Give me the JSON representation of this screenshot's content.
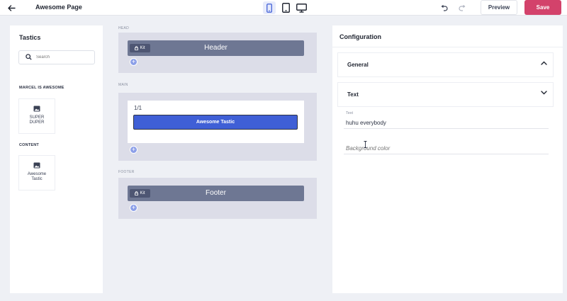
{
  "topbar": {
    "page_title": "Awesome Page",
    "back_icon": "arrow-left-icon",
    "devices": [
      "mobile-icon",
      "tablet-icon",
      "desktop-icon"
    ],
    "active_device": "mobile",
    "preview_label": "Preview",
    "save_label": "Save",
    "save_color": "#d3426b",
    "accent_color": "#3f5fd6"
  },
  "sidebar": {
    "title": "Tastics",
    "search_placeholder": "Search",
    "groups": [
      {
        "label": "MARCEL IS AWESOME",
        "items": [
          {
            "label": "SUPER DUPER",
            "icon": "image-icon"
          }
        ]
      },
      {
        "label": "CONTENT",
        "items": [
          {
            "label": "Awesome Tastic",
            "icon": "image-icon"
          }
        ]
      }
    ]
  },
  "canvas": {
    "head": {
      "label": "HEAD",
      "kit_label": "Kit",
      "block_title": "Header"
    },
    "main": {
      "label": "MAIN",
      "fraction": "1/1",
      "tastic_label": "Awesome Tastic"
    },
    "footer": {
      "label": "FOOTER",
      "kit_label": "Kit",
      "block_title": "Footer"
    }
  },
  "config": {
    "title": "Configuration",
    "sections": [
      {
        "label": "General",
        "expanded": true
      },
      {
        "label": "Text",
        "expanded": false
      }
    ],
    "text_field": {
      "label": "Text",
      "value": "huhu everybody"
    },
    "background_field": {
      "placeholder": "Background color"
    }
  }
}
